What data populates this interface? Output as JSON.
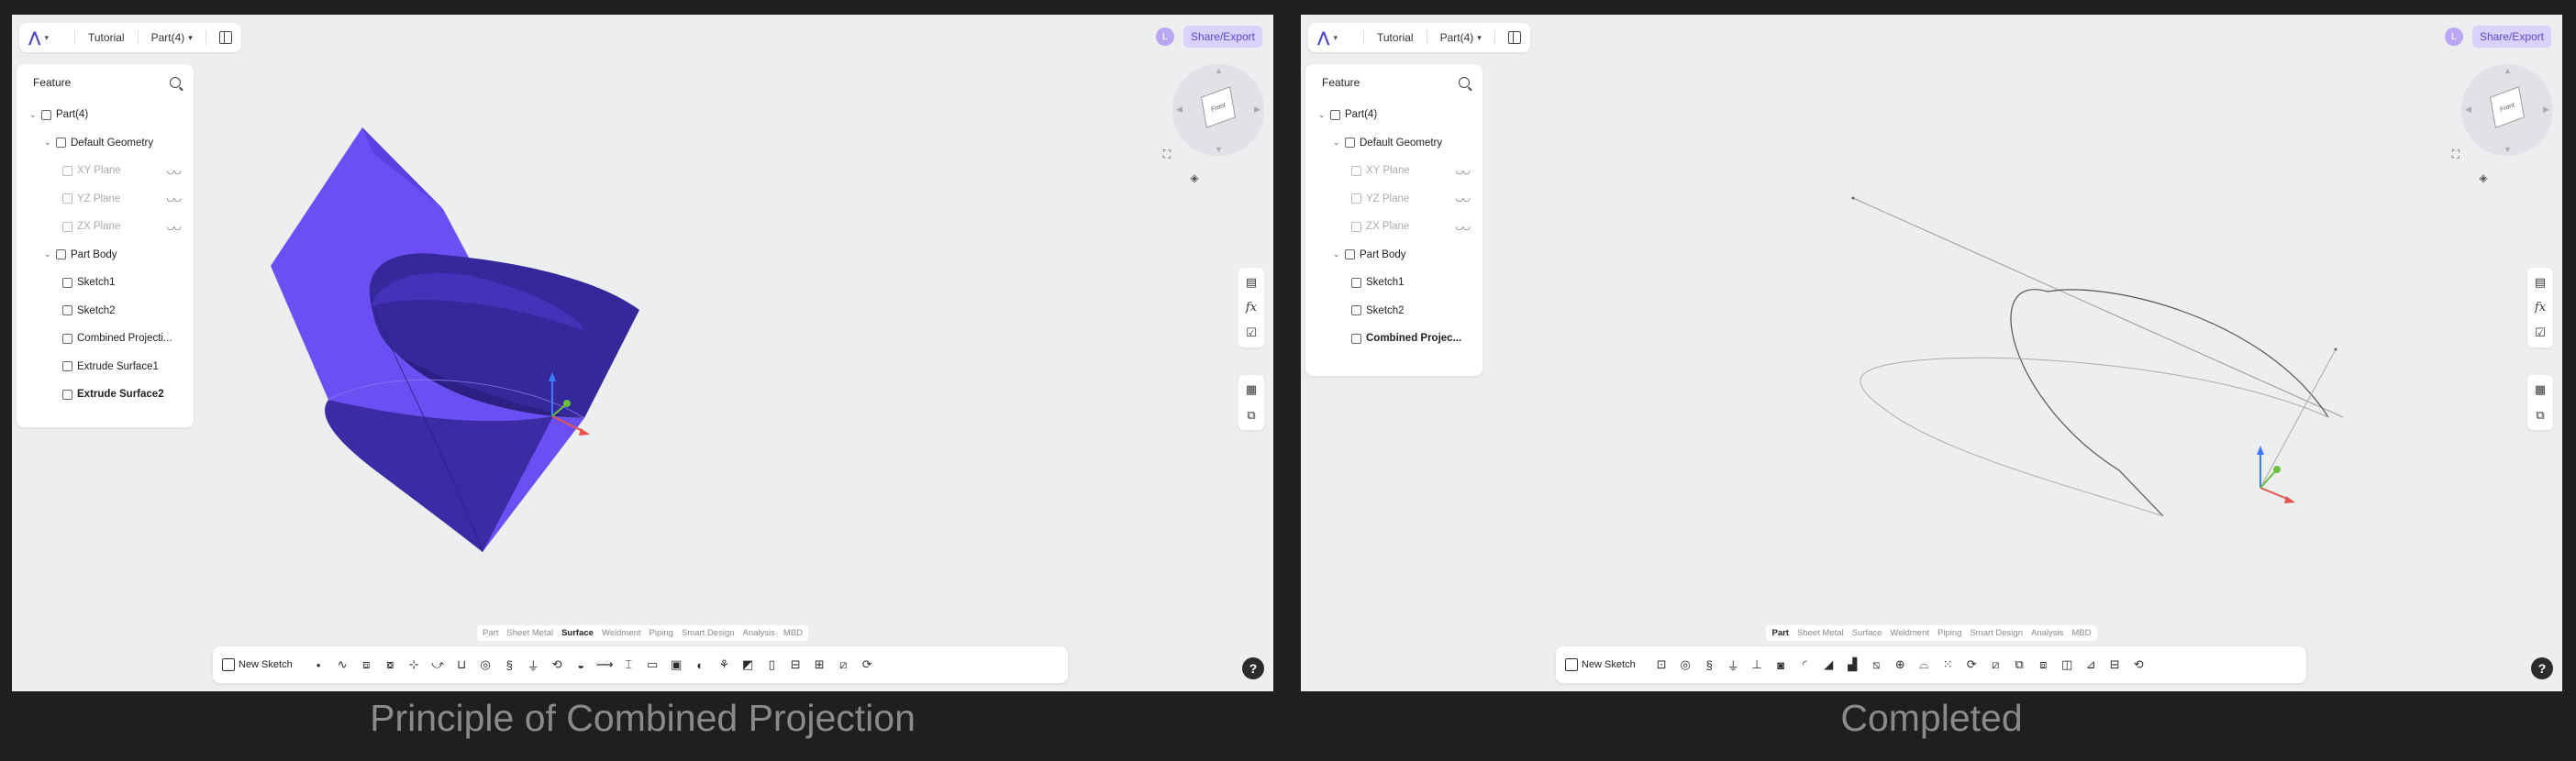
{
  "topbar": {
    "crumb": "Tutorial",
    "part": "Part(4)"
  },
  "topright": {
    "avatar": "L",
    "share": "Share/Export"
  },
  "tree": {
    "title": "Feature",
    "left_items": [
      "Part(4)",
      "Default Geometry",
      "XY Plane",
      "YZ Plane",
      "ZX Plane",
      "Part Body",
      "Sketch1",
      "Sketch2",
      "Combined Projecti...",
      "Extrude Surface1",
      "Extrude Surface2"
    ],
    "right_items": [
      "Part(4)",
      "Default Geometry",
      "XY Plane",
      "YZ Plane",
      "ZX Plane",
      "Part Body",
      "Sketch1",
      "Sketch2",
      "Combined Projec..."
    ]
  },
  "viewcube": {
    "face": "Front"
  },
  "tabs": [
    "Part",
    "Sheet Metal",
    "Surface",
    "Weldment",
    "Piping",
    "Smart Design",
    "Analysis",
    "MBD"
  ],
  "left_active_tab": "Surface",
  "right_active_tab": "Part",
  "cmd": {
    "new_sketch": "New Sketch"
  },
  "help": "?",
  "captions": {
    "left": "Principle of Combined Projection",
    "right": "Completed"
  },
  "colors": {
    "surface_light": "#6a4ef2",
    "surface_dark": "#3a2ca3",
    "accent": "#5b46d6"
  },
  "icons": {
    "sidetools_top": [
      "document-icon",
      "fx-icon",
      "checklist-icon"
    ],
    "sidetools_bottom": [
      "grid-icon",
      "copy-icon"
    ]
  }
}
